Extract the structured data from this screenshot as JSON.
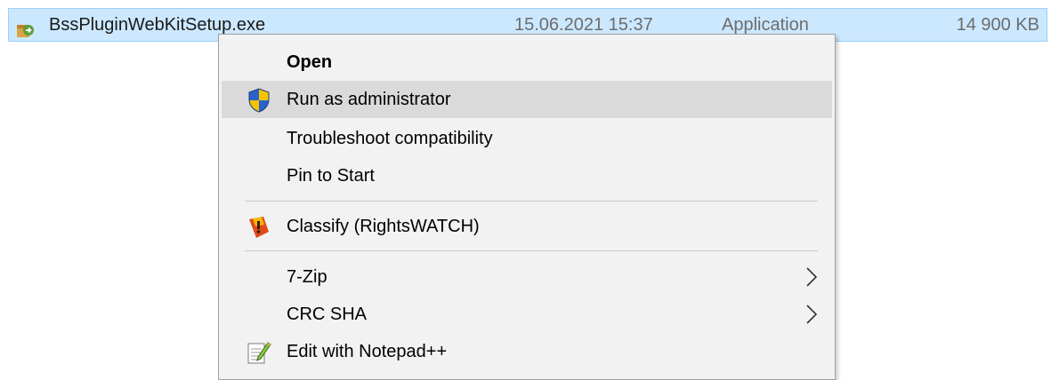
{
  "file": {
    "icon": "exe-installer-icon",
    "name": "BssPluginWebKitSetup.exe",
    "date": "15.06.2021 15:37",
    "type": "Application",
    "size": "14 900 KB"
  },
  "menu": {
    "open": "Open",
    "run_as_admin": "Run as administrator",
    "troubleshoot": "Troubleshoot compatibility",
    "pin_to_start": "Pin to Start",
    "classify": "Classify (RightsWATCH)",
    "seven_zip": "7-Zip",
    "crc_sha": "CRC SHA",
    "edit_notepad": "Edit with Notepad++"
  },
  "colors": {
    "selection_bg": "#cce8ff",
    "selection_border": "#99d1ff",
    "menu_bg": "#f2f2f2",
    "hover_bg": "#dadada"
  }
}
